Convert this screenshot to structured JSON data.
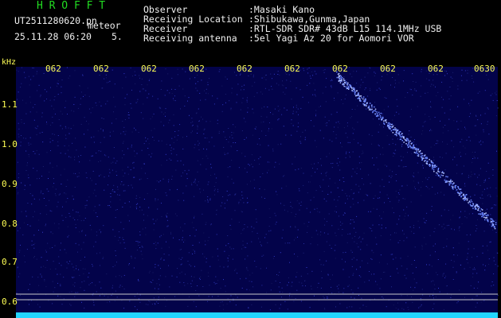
{
  "header": {
    "brand": "H R O F F T",
    "filename": "UT2511280620.pn",
    "meteor_label": "meteor",
    "date_time": "25.11.28 06:20",
    "count": "5.",
    "fields": [
      {
        "label": "Observer",
        "value": ":Masaki Kano"
      },
      {
        "label": "Receiving Location",
        "value": ":Shibukawa,Gunma,Japan"
      },
      {
        "label": "Receiver",
        "value": ":RTL-SDR SDR# 43dB L15 114.1MHz USB"
      },
      {
        "label": "Receiving antenna",
        "value": ":5el Yagi Az 20 for Aomori VOR"
      }
    ]
  },
  "axes": {
    "y_unit": "kHz",
    "y_ticks": [
      "1.1",
      "1.0",
      "0.9",
      "0.8",
      "0.7",
      "0.6"
    ],
    "x_ticks": [
      "062",
      "062",
      "062",
      "062",
      "062",
      "062",
      "062",
      "062",
      "062",
      "0630"
    ]
  },
  "colors": {
    "background": "#000000",
    "spectrogram": "#03034a",
    "trace": "#6a86ff",
    "baseline": "#22d6ff",
    "tick_text": "#ffff55",
    "header_text": "#f0f0f0",
    "brand_text": "#22dd22"
  }
}
